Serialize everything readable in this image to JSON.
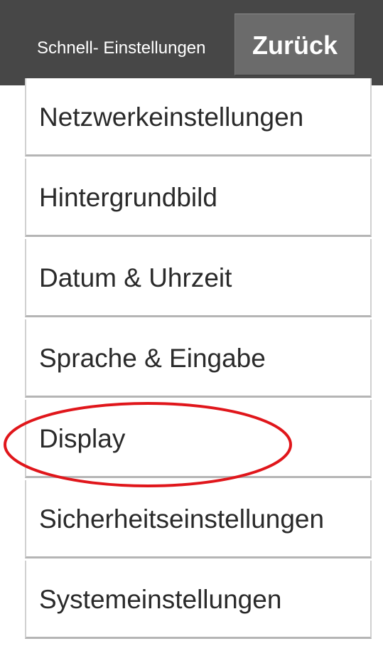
{
  "header": {
    "title": "Schnell- Einstellungen",
    "back_label": "Zurück"
  },
  "menu": {
    "items": [
      {
        "label": "Netzwerkeinstellungen"
      },
      {
        "label": "Hintergrundbild"
      },
      {
        "label": "Datum & Uhrzeit"
      },
      {
        "label": "Sprache & Eingabe"
      },
      {
        "label": "Display"
      },
      {
        "label": "Sicherheitseinstellungen"
      },
      {
        "label": "Systemeinstellungen"
      }
    ]
  },
  "colors": {
    "header_background": "#474747",
    "button_background": "#6b6b6b",
    "highlight": "#e0161b"
  }
}
